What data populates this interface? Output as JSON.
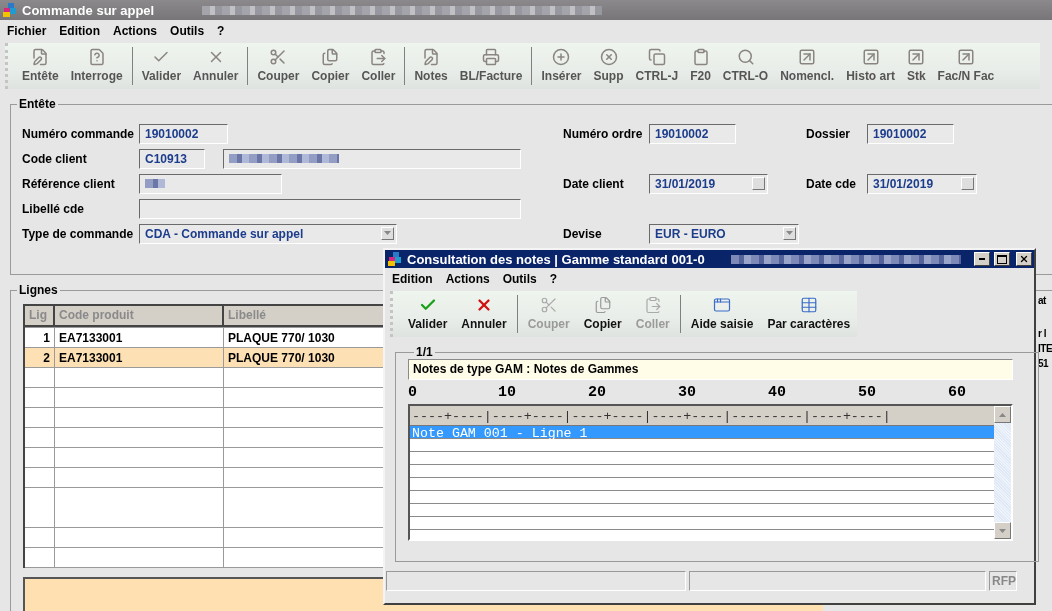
{
  "window": {
    "title": "Commande sur appel"
  },
  "menu": [
    "Fichier",
    "Edition",
    "Actions",
    "Outils",
    "?"
  ],
  "toolbar": {
    "groups": [
      {
        "buttons": [
          "Entête",
          "Interroge"
        ]
      },
      {
        "buttons": [
          "Valider",
          "Annuler"
        ]
      },
      {
        "buttons": [
          "Couper",
          "Copier",
          "Coller"
        ]
      },
      {
        "buttons": [
          "Notes",
          "BL/Facture"
        ]
      },
      {
        "buttons": [
          "Insérer",
          "Supp",
          "CTRL-J",
          "F20",
          "CTRL-O",
          "Nomencl.",
          "Histo art",
          "Stk",
          "Fac/N Fac"
        ]
      }
    ]
  },
  "header": {
    "legend": "Entête",
    "numero_commande": {
      "label": "Numéro commande",
      "value": "19010002"
    },
    "numero_ordre": {
      "label": "Numéro ordre",
      "value": "19010002"
    },
    "dossier": {
      "label": "Dossier",
      "value": "19010002"
    },
    "code_client": {
      "label": "Code client",
      "value": "C10913"
    },
    "reference_client": {
      "label": "Référence client"
    },
    "date_client": {
      "label": "Date client",
      "value": "31/01/2019"
    },
    "date_cde": {
      "label": "Date cde",
      "value": "31/01/2019"
    },
    "libelle_cde": {
      "label": "Libellé cde"
    },
    "type_commande": {
      "label": "Type de commande",
      "value": "CDA - Commande sur appel"
    },
    "devise": {
      "label": "Devise",
      "value": "EUR - EURO"
    }
  },
  "lines": {
    "legend": "Lignes",
    "columns": [
      "Lig",
      "Code produit",
      "Libellé"
    ],
    "rows": [
      {
        "lig": "1",
        "code": "EA7133001",
        "libelle": "PLAQUE  770/ 1030",
        "selected": false
      },
      {
        "lig": "2",
        "code": "EA7133001",
        "libelle": "PLAQUE  770/ 1030",
        "selected": true
      }
    ],
    "side_fragments": [
      "at",
      "r l",
      "ITE",
      "51"
    ]
  },
  "dialog": {
    "title": "Consultation des notes | Gamme standard 001-0",
    "menu": [
      "Edition",
      "Actions",
      "Outils",
      "?"
    ],
    "toolbar": {
      "groups": [
        {
          "buttons": [
            {
              "label": "Valider",
              "disabled": false
            },
            {
              "label": "Annuler",
              "disabled": false
            }
          ]
        },
        {
          "buttons": [
            {
              "label": "Couper",
              "disabled": true
            },
            {
              "label": "Copier",
              "disabled": false
            },
            {
              "label": "Coller",
              "disabled": true
            }
          ]
        },
        {
          "buttons": [
            {
              "label": "Aide saisie",
              "disabled": false
            },
            {
              "label": "Par caractères",
              "disabled": false
            }
          ]
        }
      ]
    },
    "panel": {
      "legend": "1/1",
      "note_type": "Notes de type GAM : Notes de Gammes",
      "ruler": [
        "0",
        "10",
        "20",
        "30",
        "40",
        "50",
        "60"
      ],
      "ruler_line": "----+----|----+----|----+----|----+----|---------|----+----|",
      "lines": [
        {
          "text": "Note GAM 001 - Ligne 1",
          "selected": true
        }
      ]
    },
    "status": {
      "code": "RFP"
    }
  }
}
